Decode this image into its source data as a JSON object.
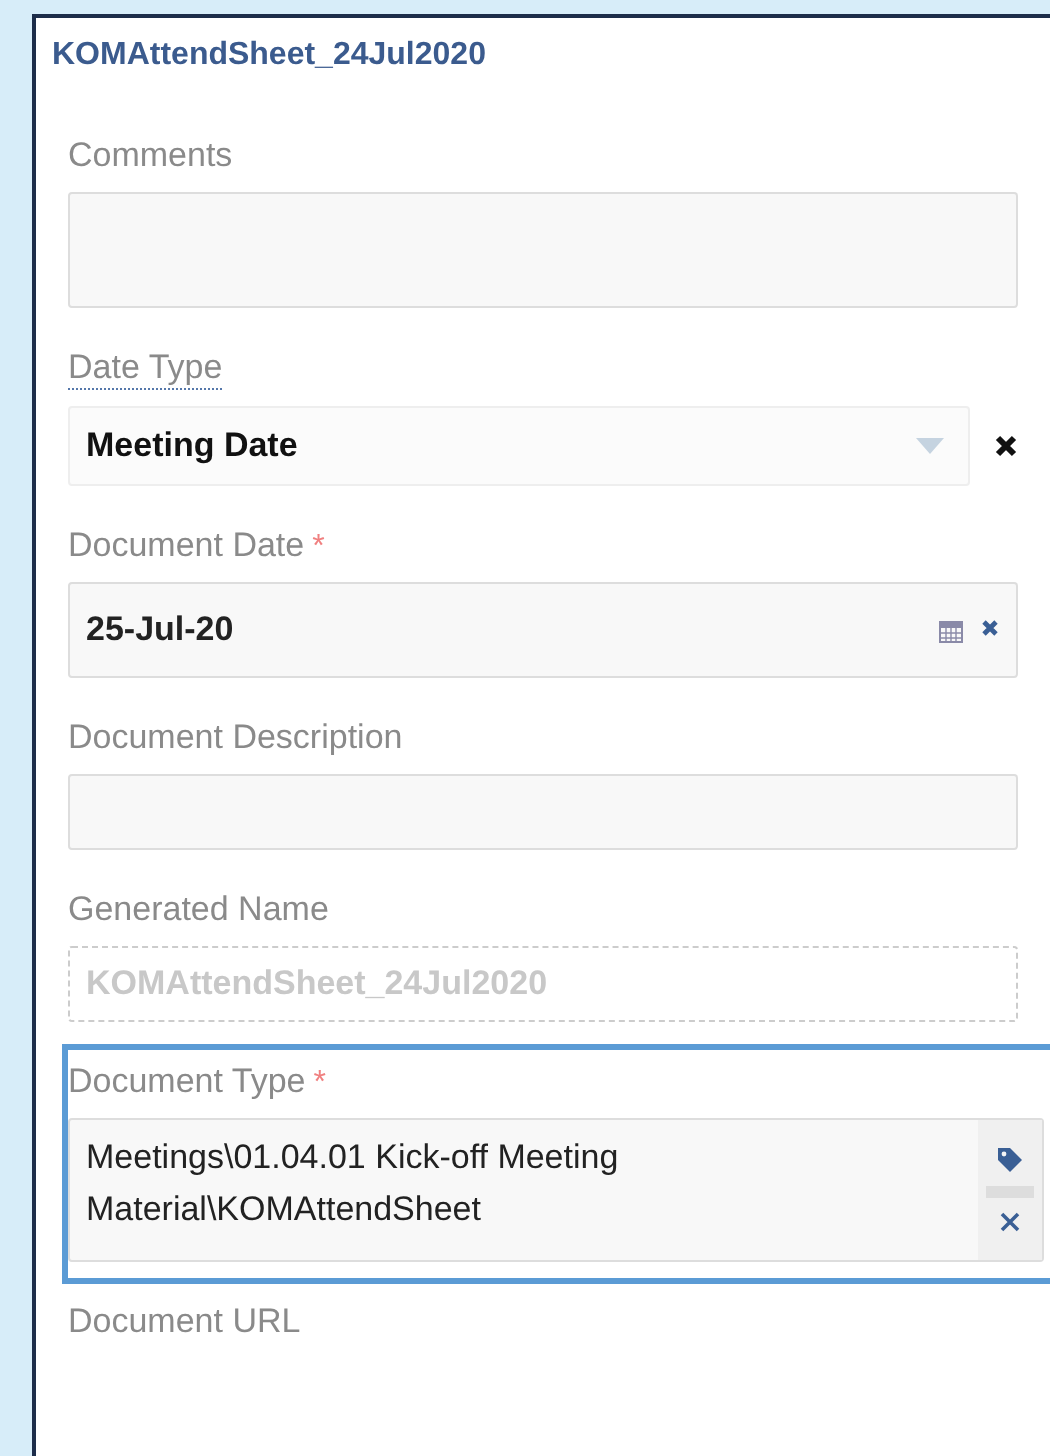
{
  "panel": {
    "title": "KOMAttendSheet_24Jul2020"
  },
  "fields": [
    {
      "kind": "textarea",
      "label": "Comments",
      "hint": false,
      "focused": false
    },
    {
      "kind": "select",
      "label": "Date Type",
      "hint": true,
      "focused": false,
      "value": "Meeting Date"
    },
    {
      "kind": "date",
      "label": "Document Date",
      "required_mark": "*",
      "hint": false,
      "focused": false,
      "value": "25-Jul-20"
    },
    {
      "kind": "text",
      "label": "Document Description",
      "hint": false,
      "focused": false
    },
    {
      "kind": "readonly",
      "label": "Generated Name",
      "hint": false,
      "focused": false,
      "value": "KOMAttendSheet_24Jul2020"
    },
    {
      "kind": "tree",
      "label": "Document Type",
      "required_mark": "*",
      "hint": false,
      "focused": true,
      "value": "Meetings\\01.04.01 Kick-off Meeting Material\\KOMAttendSheet"
    },
    {
      "kind": "label",
      "label": "Document URL",
      "hint": false,
      "focused": false
    }
  ]
}
